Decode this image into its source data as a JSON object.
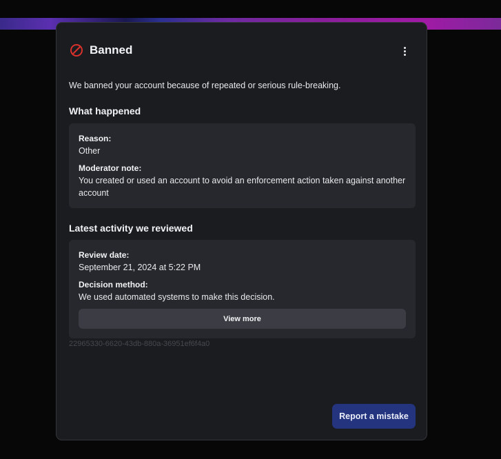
{
  "dialog": {
    "title": "Banned",
    "status_icon": "ban-icon",
    "menu_icon": "more-vertical-icon",
    "intro": "We banned your account because of repeated or serious rule-breaking."
  },
  "what_happened": {
    "heading": "What happened",
    "reason_label": "Reason:",
    "reason_value": "Other",
    "note_label": "Moderator note:",
    "note_value": "You created or used an account to avoid an enforcement action taken against another account"
  },
  "latest_activity": {
    "heading": "Latest activity we reviewed",
    "review_date_label": "Review date:",
    "review_date_value": "September 21, 2024 at 5:22 PM",
    "decision_label": "Decision method:",
    "decision_value": "We used automated systems to make this decision.",
    "view_more_label": "View more"
  },
  "reference_id": "22965330-6620-43db-880a-36951ef6f4a0",
  "actions": {
    "report_label": "Report a mistake"
  },
  "colors": {
    "ban_icon": "#d9312b",
    "report_button": "#24347e",
    "panel": "#1b1c20",
    "box": "#27282d"
  }
}
